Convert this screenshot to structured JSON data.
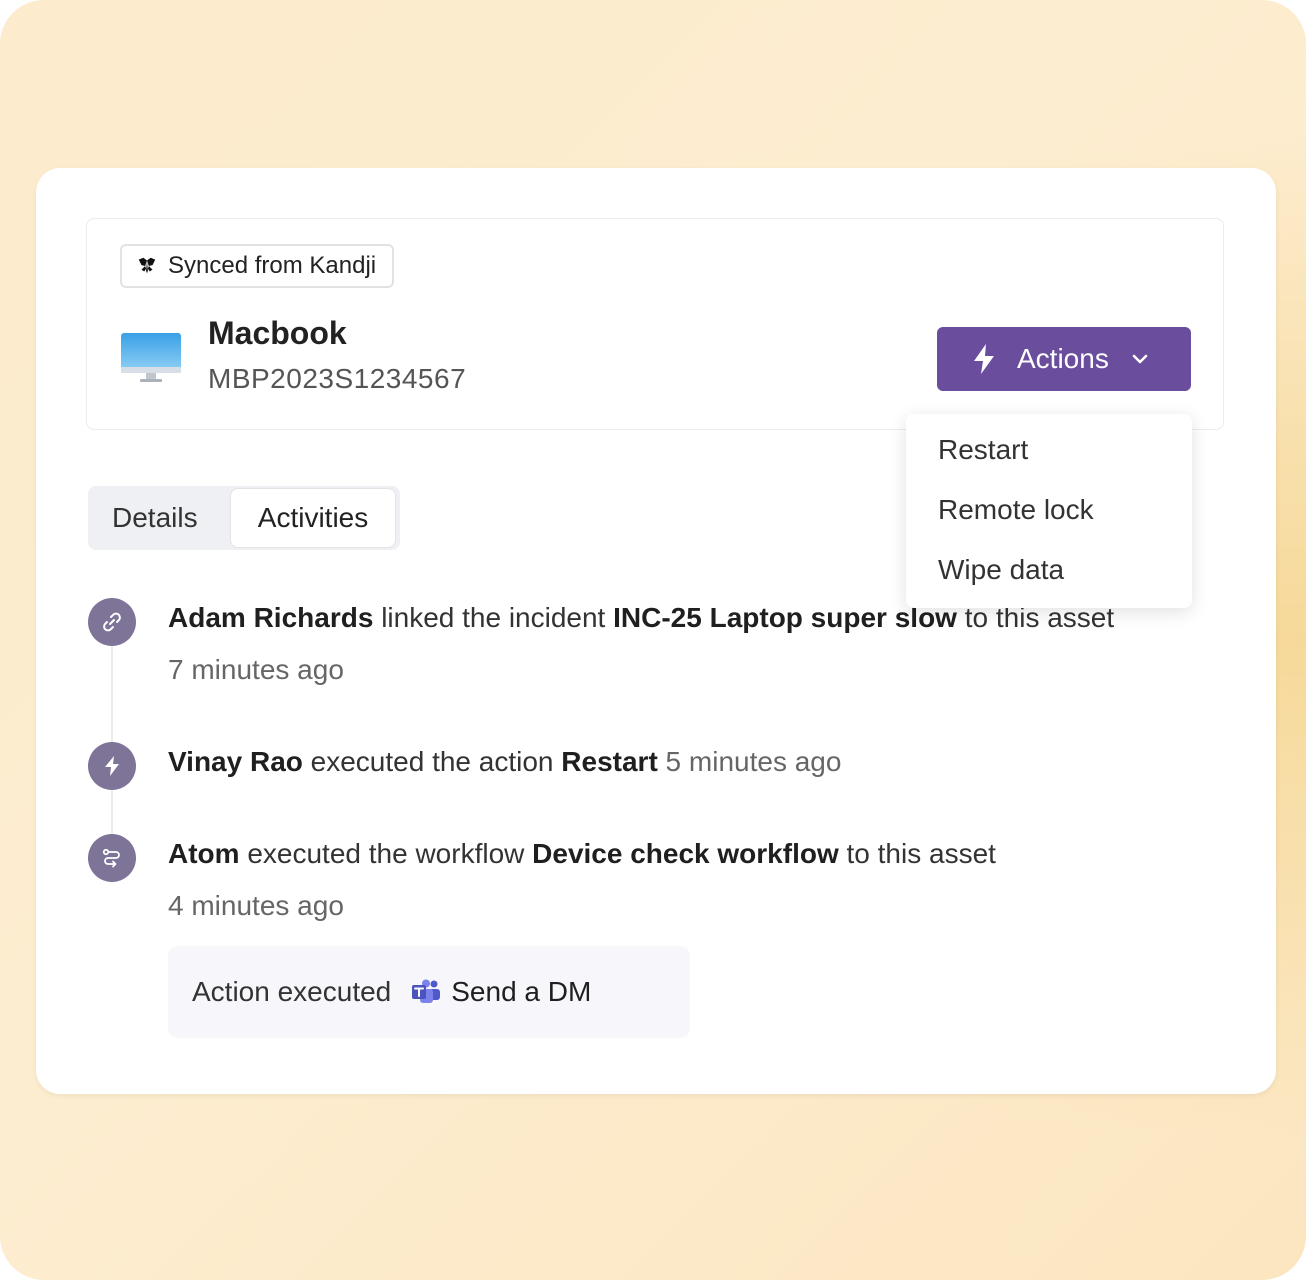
{
  "asset": {
    "synced_label": "Synced from Kandji",
    "name": "Macbook",
    "serial": "MBP2023S1234567"
  },
  "actions": {
    "button_label": "Actions",
    "menu": [
      "Restart",
      "Remote lock",
      "Wipe data"
    ]
  },
  "tabs": {
    "details": "Details",
    "activities": "Activities",
    "active": "Activities"
  },
  "activities": [
    {
      "icon": "link-icon",
      "actor": "Adam Richards",
      "verb": "linked the incident",
      "object": "INC-25 Laptop super slow",
      "suffix": "to this asset",
      "time": "7 minutes ago"
    },
    {
      "icon": "bolt-icon",
      "actor": "Vinay Rao",
      "verb": "executed the action",
      "object": "Restart",
      "time": "5 minutes ago"
    },
    {
      "icon": "workflow-icon",
      "actor": "Atom",
      "verb": "executed the workflow",
      "object": "Device check workflow",
      "suffix": "to this asset",
      "time": "4 minutes ago",
      "detail": {
        "label": "Action executed",
        "target_icon": "teams-icon",
        "target": "Send a DM"
      }
    }
  ],
  "colors": {
    "accent": "#6b4d9e",
    "timeline_icon": "#7d7498"
  }
}
